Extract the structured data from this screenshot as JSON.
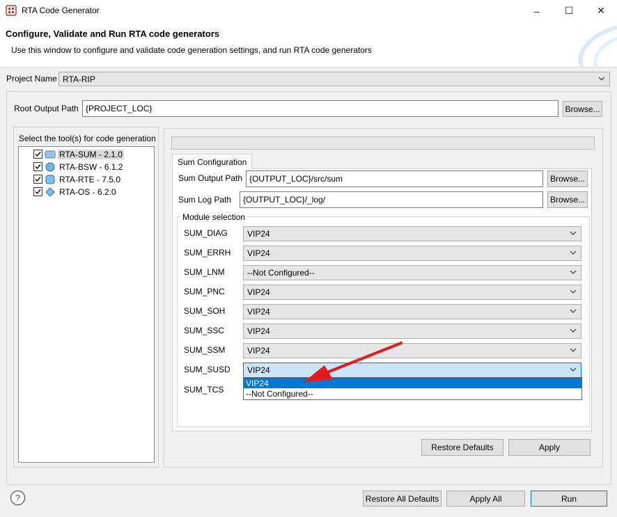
{
  "window": {
    "title": "RTA Code Generator",
    "minimize": "–",
    "maximize": "☐",
    "close": "✕"
  },
  "banner": {
    "title": "Configure, Validate and Run RTA code generators",
    "description": "Use this window to configure and validate code generation settings, and run RTA code generators"
  },
  "project": {
    "label": "Project Name",
    "value": "RTA-RIP"
  },
  "root_output": {
    "label": "Root Output Path",
    "value": "{PROJECT_LOC}",
    "browse": "Browse..."
  },
  "tools": {
    "label": "Select the tool(s) for code generation",
    "items": [
      {
        "label": "RTA-SUM - 2.1.0",
        "checked": true,
        "selected": true
      },
      {
        "label": "RTA-BSW - 6.1.2",
        "checked": true,
        "selected": false
      },
      {
        "label": "RTA-RTE - 7.5.0",
        "checked": true,
        "selected": false
      },
      {
        "label": "RTA-OS - 6.2.0",
        "checked": true,
        "selected": false
      }
    ]
  },
  "sum_config": {
    "tab_label": "Sum Configuration",
    "output_path_label": "Sum Output Path",
    "output_path_value": "{OUTPUT_LOC}/src/sum",
    "log_path_label": "Sum Log Path",
    "log_path_value": "{OUTPUT_LOC}/_log/",
    "browse": "Browse...",
    "module_selection_label": "Module selection",
    "modules": [
      {
        "name": "SUM_DIAG",
        "value": "VIP24"
      },
      {
        "name": "SUM_ERRH",
        "value": "VIP24"
      },
      {
        "name": "SUM_LNM",
        "value": "--Not Configured--"
      },
      {
        "name": "SUM_PNC",
        "value": "VIP24"
      },
      {
        "name": "SUM_SOH",
        "value": "VIP24"
      },
      {
        "name": "SUM_SSC",
        "value": "VIP24"
      },
      {
        "name": "SUM_SSM",
        "value": "VIP24"
      },
      {
        "name": "SUM_SUSD",
        "value": "VIP24"
      },
      {
        "name": "SUM_TCS",
        "value": ""
      }
    ],
    "dropdown_options": [
      "VIP24",
      "--Not Configured--"
    ],
    "restore_defaults": "Restore Defaults",
    "apply": "Apply"
  },
  "footer": {
    "help_icon": "?",
    "restore_all": "Restore All Defaults",
    "apply_all": "Apply All",
    "run": "Run"
  },
  "colors": {
    "accent": "#0078d7",
    "arrow": "#e51b1b",
    "selection": "#cce4f7"
  }
}
